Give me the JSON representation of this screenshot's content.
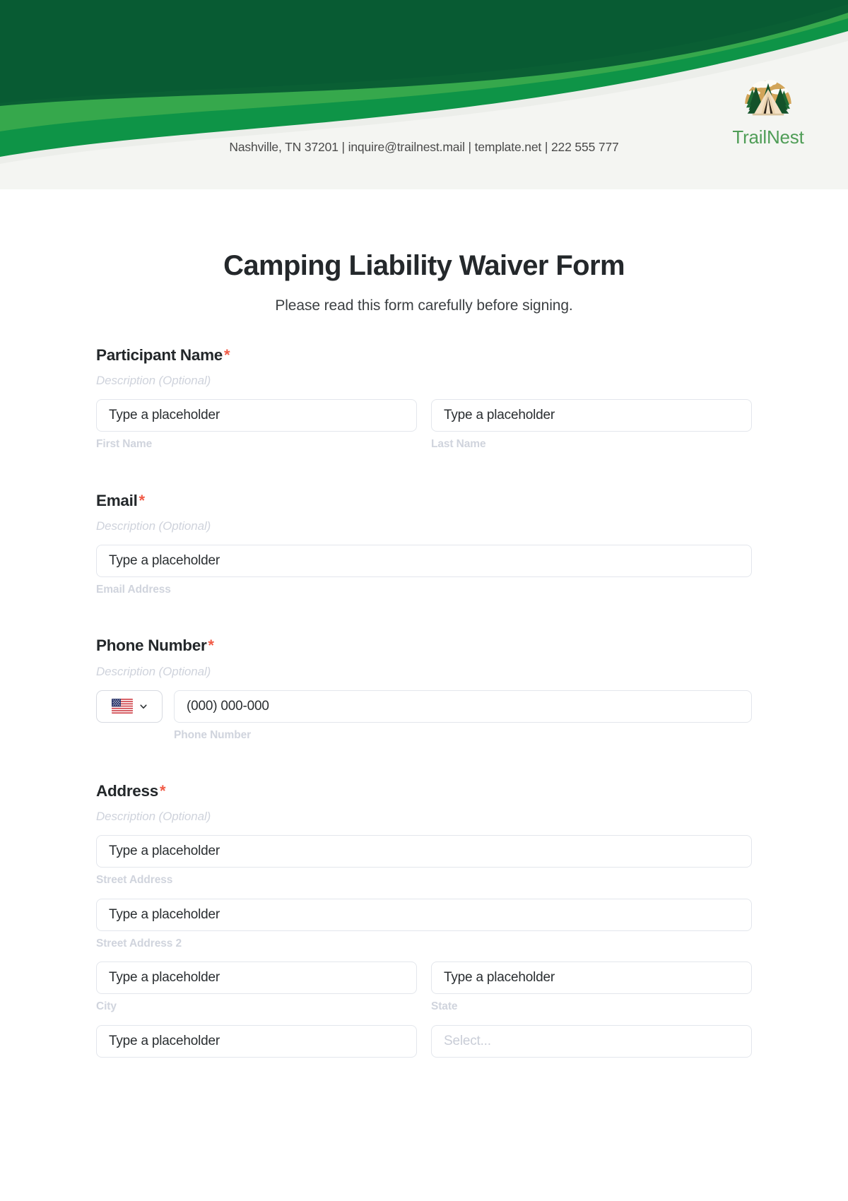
{
  "brand": {
    "name": "TrailNest",
    "logo_icon": "camping-tent-forest-logo",
    "contact": "Nashville, TN 37201 | inquire@trailnest.mail | template.net | 222 555 777",
    "colors": {
      "header_dark_green": "#085C33",
      "header_mid_green": "#0E9447",
      "header_light_green": "#36A84C",
      "header_bg": "#F4F5F2",
      "brand_text": "#4F9D57",
      "logo_sun": "#D2A458",
      "logo_tree": "#1C5B2E",
      "logo_tent": "#F3E0C4",
      "required_star": "#F15A46"
    }
  },
  "form": {
    "title": "Camping Liability Waiver Form",
    "subtitle": "Please read this form carefully before signing.",
    "description_placeholder": "Description (Optional)",
    "required_marker": "*",
    "fields": [
      {
        "label": "Participant Name",
        "required": true,
        "description": "Description (Optional)",
        "inputs": [
          {
            "placeholder": "Type a placeholder",
            "sub_label": "First Name",
            "type": "text"
          },
          {
            "placeholder": "Type a placeholder",
            "sub_label": "Last Name",
            "type": "text"
          }
        ]
      },
      {
        "label": "Email",
        "required": true,
        "description": "Description (Optional)",
        "inputs": [
          {
            "placeholder": "Type a placeholder",
            "sub_label": "Email Address",
            "type": "email"
          }
        ]
      },
      {
        "label": "Phone Number",
        "required": true,
        "description": "Description (Optional)",
        "country_code_icon": "us-flag-icon",
        "country_chevron_icon": "chevron-down-icon",
        "inputs": [
          {
            "placeholder": "(000) 000-000",
            "sub_label": "Phone Number",
            "type": "tel"
          }
        ]
      },
      {
        "label": "Address",
        "required": true,
        "description": "Description (Optional)",
        "inputs": [
          {
            "placeholder": "Type a placeholder",
            "sub_label": "Street Address",
            "type": "text"
          },
          {
            "placeholder": "Type a placeholder",
            "sub_label": "Street Address 2",
            "type": "text"
          },
          {
            "placeholder": "Type a placeholder",
            "sub_label": "City",
            "type": "text"
          },
          {
            "placeholder": "Type a placeholder",
            "sub_label": "State",
            "type": "text"
          },
          {
            "placeholder": "Type a placeholder",
            "sub_label": "",
            "type": "text"
          },
          {
            "placeholder": "Select...",
            "sub_label": "",
            "type": "select"
          }
        ]
      }
    ]
  }
}
